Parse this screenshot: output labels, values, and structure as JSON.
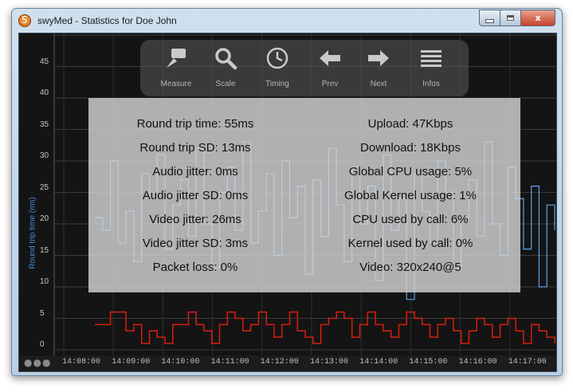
{
  "window": {
    "title": "swyMed - Statistics for Doe John",
    "app_icon": "swymed-logo-icon",
    "buttons": [
      "minimize-icon",
      "maximize-icon",
      "close-icon"
    ],
    "close_label": "x"
  },
  "toolbar": {
    "items": [
      {
        "label": "Measure",
        "icon": "measure-icon"
      },
      {
        "label": "Scale",
        "icon": "magnifier-icon"
      },
      {
        "label": "Timing",
        "icon": "clock-icon"
      },
      {
        "label": "Prev",
        "icon": "arrow-left-icon"
      },
      {
        "label": "Next",
        "icon": "arrow-right-icon"
      },
      {
        "label": "Infos",
        "icon": "list-icon"
      }
    ]
  },
  "stats": {
    "left": [
      "Round trip time: 55ms",
      "Round trip SD: 13ms",
      "Audio jitter: 0ms",
      "Audio jitter SD: 0ms",
      "Video jitter: 26ms",
      "Video jitter SD: 3ms",
      "Packet loss: 0%"
    ],
    "right": [
      "Upload: 47Kbps",
      "Download: 18Kbps",
      "Global CPU usage: 5%",
      "Global Kernel usage: 1%",
      "CPU used by call: 6%",
      "Kernel used by call: 0%",
      "Video: 320x240@5"
    ]
  },
  "chart_data": {
    "type": "line",
    "ylabel": "Round trip time (ms)",
    "ylim": [
      0,
      50
    ],
    "yticks": [
      "0",
      "5",
      "10",
      "15",
      "20",
      "25",
      "30",
      "35",
      "40",
      "45",
      "50"
    ],
    "x": [
      "14:08:00",
      "14:09:00",
      "14:10:00",
      "14:11:00",
      "14:12:00",
      "14:13:00",
      "14:14:00",
      "14:15:00",
      "14:16:00",
      "14:17:00"
    ],
    "colors": {
      "round_trip": "#5aa2e6",
      "secondary": "#d81e0f"
    },
    "grid": true,
    "series": [
      {
        "values": [
          21,
          19,
          30,
          17,
          22,
          14,
          28,
          24,
          31,
          16,
          23,
          27,
          18,
          32,
          20,
          13,
          25,
          29,
          19,
          33,
          17,
          22,
          28,
          15,
          30,
          21,
          26,
          12,
          27,
          18,
          32,
          23,
          14,
          29,
          20,
          26,
          11,
          31,
          19,
          24,
          8,
          28,
          22,
          17,
          30,
          25,
          13,
          21,
          27,
          18,
          33,
          20,
          15,
          29,
          24,
          16,
          26,
          10,
          23,
          19
        ]
      },
      {
        "values": [
          4,
          4,
          6,
          6,
          3,
          4,
          1,
          3,
          2,
          1,
          4,
          4,
          6,
          4,
          3,
          1,
          4,
          6,
          5,
          3,
          4,
          6,
          4,
          2,
          4,
          6,
          3,
          2,
          1,
          4,
          5,
          6,
          5,
          2,
          4,
          6,
          4,
          3,
          2,
          4,
          6,
          5,
          4,
          2,
          4,
          5,
          3,
          1,
          3,
          5,
          4,
          2,
          4,
          5,
          3,
          1,
          4,
          3,
          2,
          1
        ]
      }
    ]
  }
}
